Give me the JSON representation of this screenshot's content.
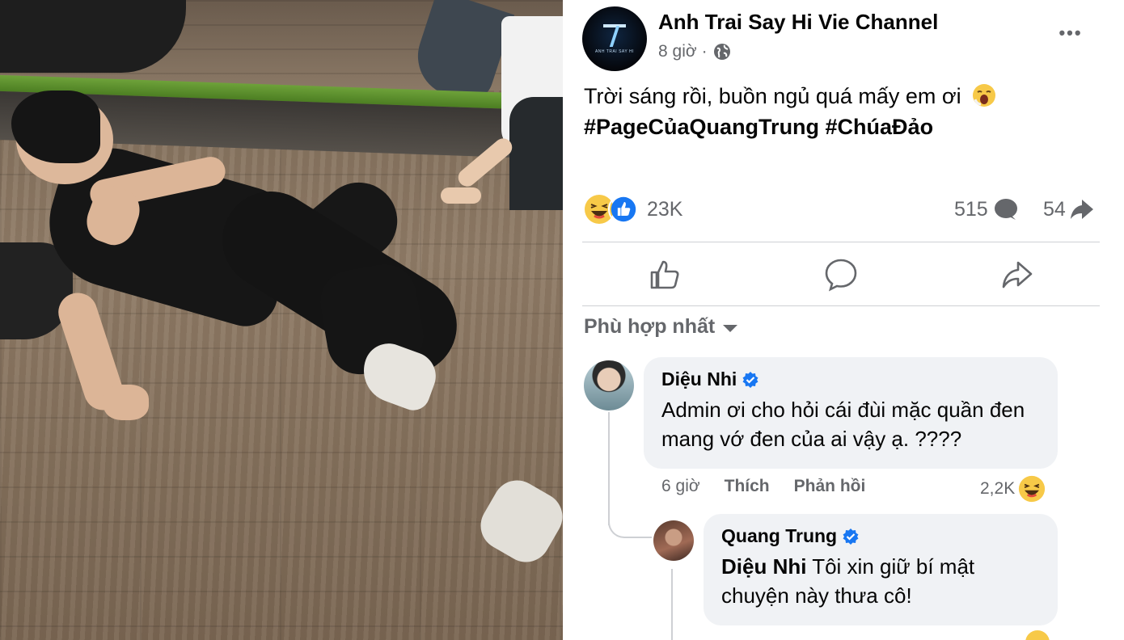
{
  "post": {
    "page_name": "Anh Trai Say Hi Vie Channel",
    "avatar_wordmark": "ANH TRAI SAY HI",
    "time": "8 giờ",
    "separator": "·",
    "privacy_icon": "globe-icon",
    "more_label": "•••",
    "text_line1": "Trời sáng rồi, buồn ngủ quá mấy em ơi",
    "text_emoji": "yawning-face-icon",
    "hashtags": "#PageCủaQuangTrung #ChúaĐảo",
    "reaction_icons": [
      "haha-icon",
      "like-icon"
    ],
    "reaction_count": "23K",
    "comment_count": "515",
    "share_count": "54"
  },
  "actions": [
    {
      "icon": "like-outline-icon"
    },
    {
      "icon": "comment-outline-icon"
    },
    {
      "icon": "share-outline-icon"
    }
  ],
  "sort_label": "Phù hợp nhất",
  "comments": [
    {
      "author": "Diệu Nhi",
      "verified": true,
      "text": "Admin ơi cho hỏi cái đùi mặc quần đen mang vớ đen của ai vậy ạ. ????",
      "time": "6 giờ",
      "like_label": "Thích",
      "reply_label": "Phản hồi",
      "reaction_count": "2,2K",
      "reaction_icon": "haha-icon"
    },
    {
      "author": "Quang Trung",
      "verified": true,
      "mention": "Diệu Nhi",
      "text": "Tôi xin giữ bí mật chuyện này thưa cô!"
    }
  ],
  "colors": {
    "text": "#050505",
    "secondary": "#65676b",
    "bubble": "#f0f2f5",
    "link_blue": "#1877f2",
    "haha_yellow": "#f7c948",
    "divider": "#ced0d4"
  }
}
